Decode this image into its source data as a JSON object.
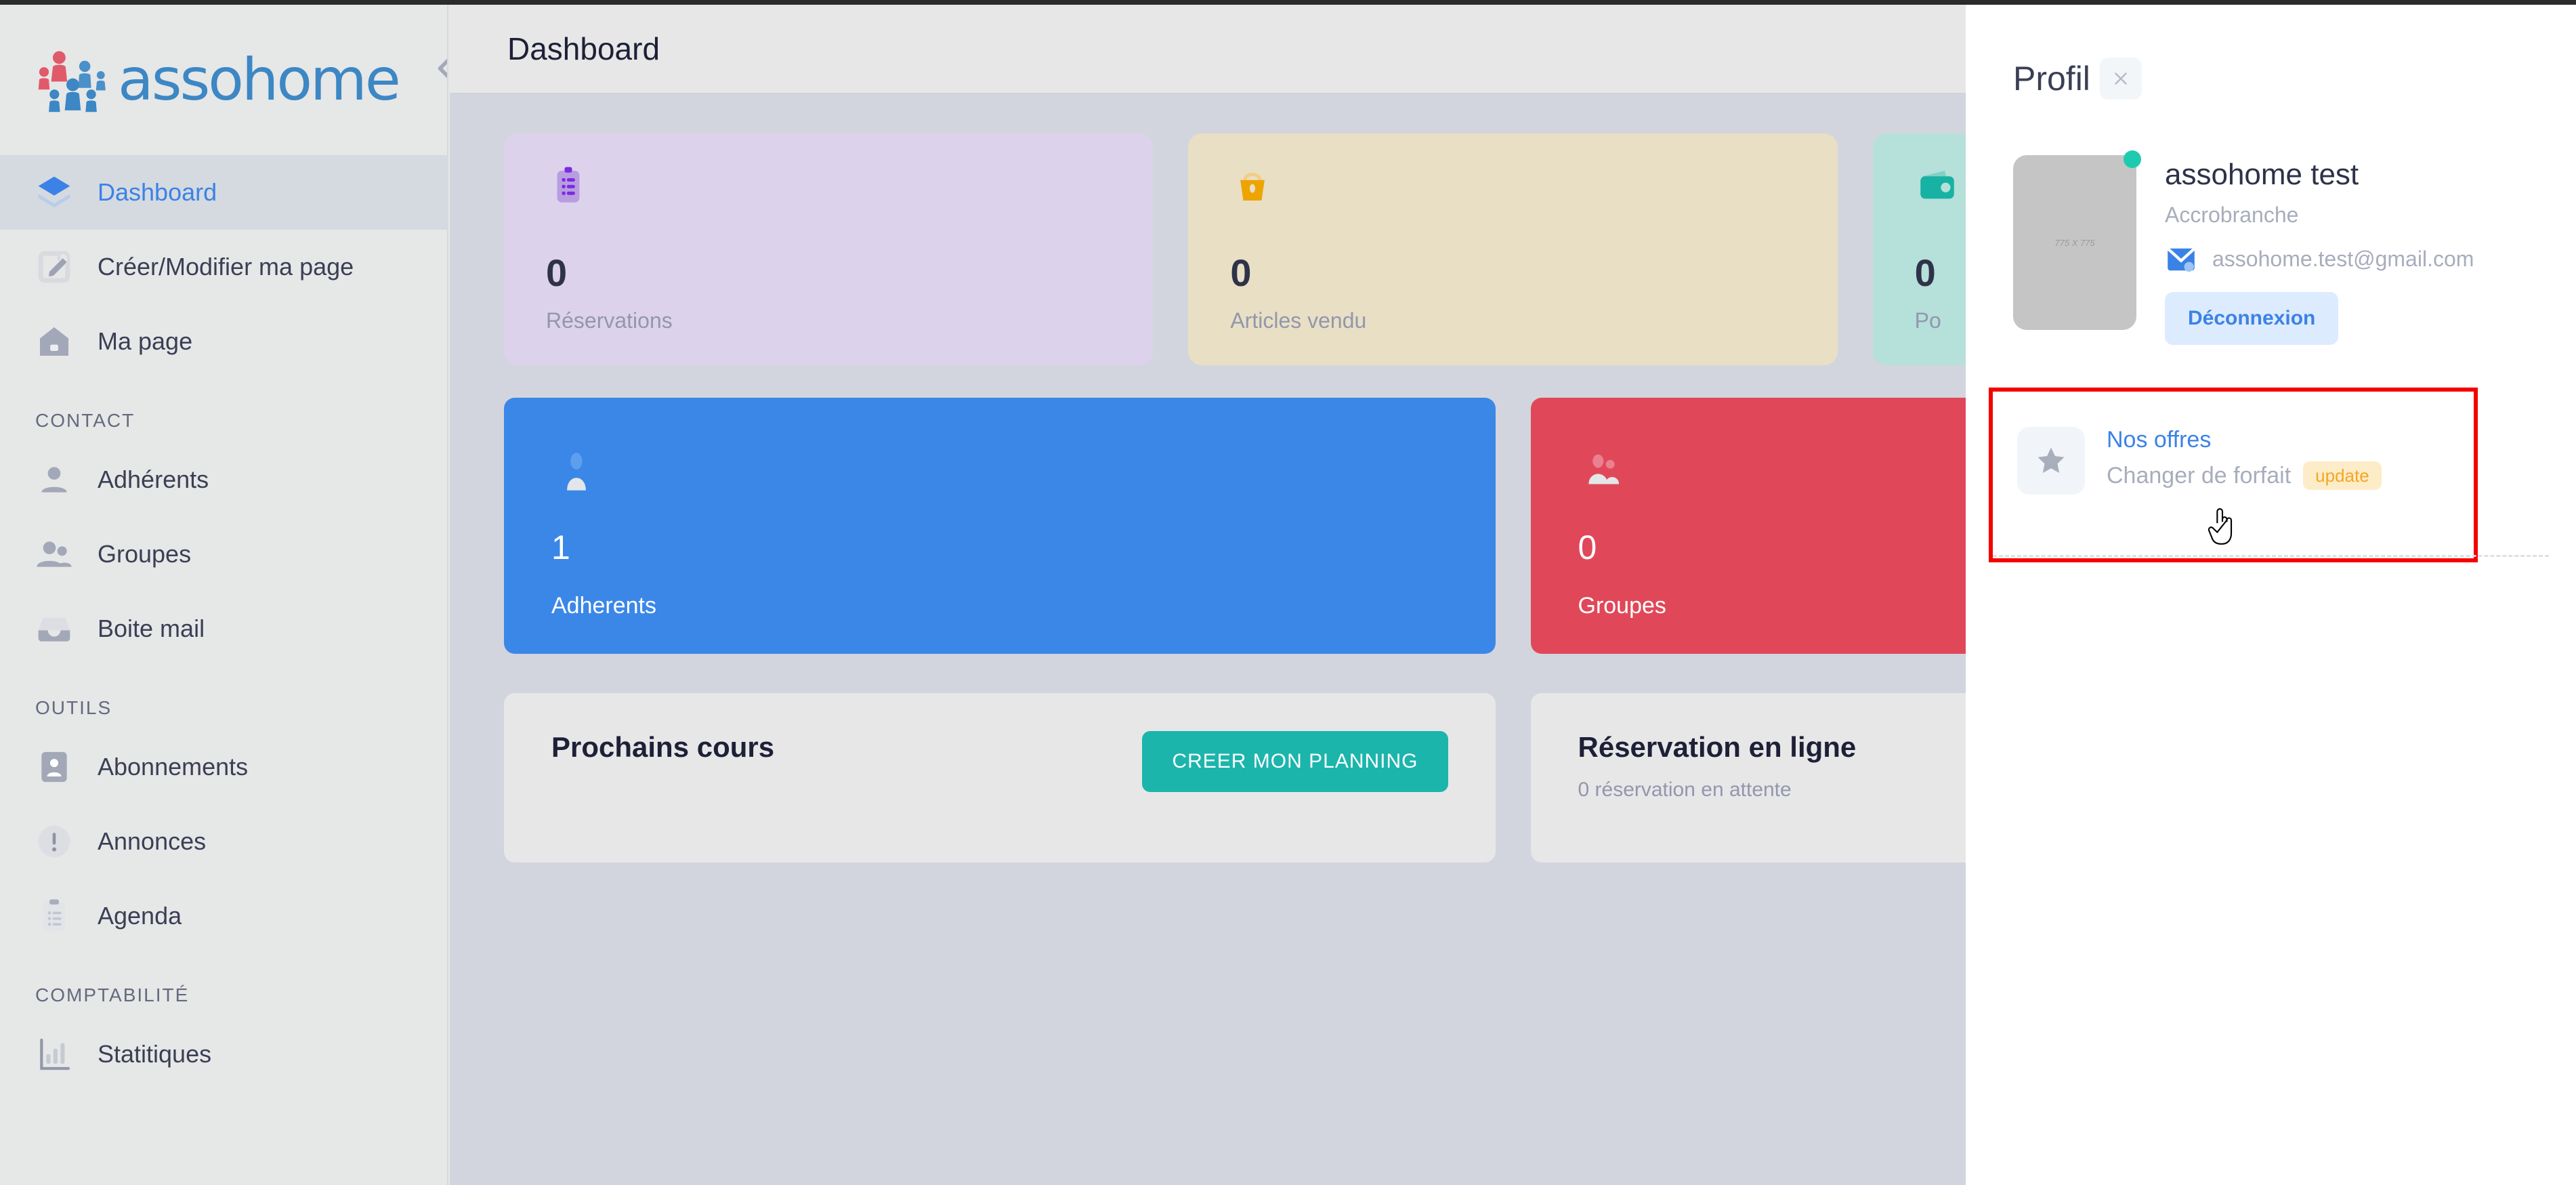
{
  "brand": {
    "name": "assohome",
    "collapse_icon": "chevron-double-left"
  },
  "sidebar": {
    "items": [
      {
        "label": "Dashboard",
        "icon": "layers-icon",
        "active": true
      },
      {
        "label": "Créer/Modifier ma page",
        "icon": "edit-square-icon",
        "active": false
      },
      {
        "label": "Ma page",
        "icon": "home-icon",
        "active": false
      }
    ],
    "sections": [
      {
        "title": "CONTACT",
        "items": [
          {
            "label": "Adhérents",
            "icon": "person-icon"
          },
          {
            "label": "Groupes",
            "icon": "people-icon"
          },
          {
            "label": "Boite mail",
            "icon": "inbox-icon"
          }
        ]
      },
      {
        "title": "OUTILS",
        "items": [
          {
            "label": "Abonnements",
            "icon": "contact-card-icon"
          },
          {
            "label": "Annonces",
            "icon": "alert-circle-icon"
          },
          {
            "label": "Agenda",
            "icon": "clipboard-list-icon"
          }
        ]
      },
      {
        "title": "COMPTABILITÉ",
        "items": [
          {
            "label": "Statitiques",
            "icon": "bar-chart-icon"
          }
        ]
      }
    ]
  },
  "header": {
    "title": "Dashboard"
  },
  "stats": [
    {
      "value": "0",
      "label": "Réservations",
      "icon": "clipboard-icon",
      "bg": "#ddd2ec",
      "icon_color": "#8b3fe0"
    },
    {
      "value": "0",
      "label": "Articles vendu",
      "icon": "shopping-basket-icon",
      "bg": "#e9dfc5",
      "icon_color": "#eda400"
    },
    {
      "value": "0",
      "label": "Po",
      "icon": "wallet-icon",
      "bg": "#b6e0da",
      "icon_color": "#17b2a3"
    }
  ],
  "big_cards": [
    {
      "value": "1",
      "label": "Adherents",
      "icon": "person-icon",
      "bg": "#3b87e8"
    },
    {
      "value": "0",
      "label": "Groupes",
      "icon": "people-icon",
      "bg": "#e04859"
    }
  ],
  "panels": [
    {
      "title": "Prochains cours",
      "subtitle": "",
      "button": "CREER MON PLANNING"
    },
    {
      "title": "Réservation en ligne",
      "subtitle": "0 réservation en attente",
      "button": ""
    }
  ],
  "profile": {
    "title": "Profil",
    "close_icon": "close-icon",
    "avatar_dimensions": "775 X 775",
    "status": "online",
    "name": "assohome test",
    "organization": "Accrobranche",
    "email": "assohome.test@gmail.com",
    "email_icon": "mail-icon",
    "logout_label": "Déconnexion",
    "offers": {
      "icon": "star-icon",
      "title": "Nos offres",
      "subtitle": "Changer de forfait",
      "badge": "update",
      "highlight_color": "#f40000"
    }
  },
  "colors": {
    "accent_blue": "#3b82e6",
    "teal": "#1bb5ac",
    "red_highlight": "#f40000",
    "badge_orange": "#f5a623",
    "status_green": "#1ecbb0"
  }
}
